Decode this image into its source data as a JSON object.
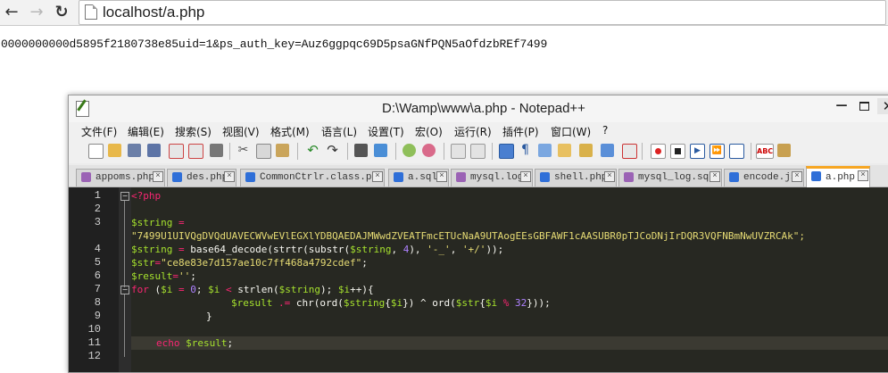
{
  "browser": {
    "back_icon": "arrow-left-icon",
    "forward_icon": "arrow-right-icon",
    "reload_icon": "reload-icon",
    "url": "localhost/a.php"
  },
  "page": {
    "output_text": "0000000000d5895f2180738e85uid=1&ps_auth_key=Auz6ggpqc69D5psaGNfPQN5aOfdzbREf7499"
  },
  "npp": {
    "title": "D:\\Wamp\\www\\a.php - Notepad++",
    "window_controls": {
      "minimize": "—",
      "close": "✕"
    },
    "menu": [
      "文件(F)",
      "编辑(E)",
      "搜索(S)",
      "视图(V)",
      "格式(M)",
      "语言(L)",
      "设置(T)",
      "宏(O)",
      "运行(R)",
      "插件(P)",
      "窗口(W)",
      "?"
    ],
    "toolbar_icons": [
      "new-file-icon",
      "open-file-icon",
      "save-icon",
      "save-all-icon",
      "close-icon",
      "close-all-icon",
      "print-icon",
      "cut-icon",
      "copy-icon",
      "paste-icon",
      "undo-icon",
      "redo-icon",
      "find-icon",
      "replace-icon",
      "zoom-in-icon",
      "zoom-out-icon",
      "sync-scroll-v-icon",
      "sync-scroll-h-icon",
      "word-wrap-icon",
      "show-all-chars-icon",
      "indent-guide-icon",
      "user-lang-icon",
      "doc-map-icon",
      "function-list-icon",
      "folder-workspace-icon",
      "record-macro-icon",
      "stop-macro-icon",
      "play-macro-icon",
      "run-macro-multiple-icon",
      "save-macro-icon",
      "spell-check-icon",
      "plugin-icon"
    ],
    "tabs": [
      {
        "label": "appoms.php",
        "active": false,
        "icon_color": "#9b63b5"
      },
      {
        "label": "des.php",
        "active": false,
        "icon_color": "#2f6fd8"
      },
      {
        "label": "CommonCtrlr.class.php",
        "active": false,
        "icon_color": "#2f6fd8"
      },
      {
        "label": "a.sql",
        "active": false,
        "icon_color": "#2f6fd8"
      },
      {
        "label": "mysql.log",
        "active": false,
        "icon_color": "#9b63b5"
      },
      {
        "label": "shell.php",
        "active": false,
        "icon_color": "#2f6fd8"
      },
      {
        "label": "mysql_log.sql",
        "active": false,
        "icon_color": "#9b63b5"
      },
      {
        "label": "encode.js",
        "active": false,
        "icon_color": "#2f6fd8"
      },
      {
        "label": "a.php",
        "active": true,
        "icon_color": "#2f6fd8"
      }
    ],
    "line_numbers": [
      "1",
      "2",
      "3",
      "4",
      "5",
      "6",
      "7",
      "8",
      "9",
      "10",
      "11",
      "12"
    ],
    "code": {
      "l1": "<?php",
      "l3a_var": "$string",
      "l3a_op": " =",
      "l3b_str": "\"7499U1UIVQgDVQdUAVECWVwEVlEGXlYDBQAEDAJMWwdZVEATFmcETUcNaA9UTAogEEsGBFAWF1cAASUBR0pTJCoDNjIrDQR3VQFNBmNwUVZRCAk\";",
      "l4_var": "$string",
      "l4_op": " = ",
      "l4_fn1": "base64_decode",
      "l4_p1": "(",
      "l4_fn2": "strtr",
      "l4_p2": "(",
      "l4_fn3": "substr",
      "l4_p3": "(",
      "l4_var2": "$string",
      "l4_c1": ", ",
      "l4_n1": "4",
      "l4_c2": "), ",
      "l4_s1": "'-_'",
      "l4_c3": ", ",
      "l4_s2": "'+/'",
      "l4_end": "));",
      "l5_var": "$str",
      "l5_op": "=",
      "l5_str": "\"ce8e83e7d157ae10c7ff468a4792cdef\"",
      "l5_end": ";",
      "l6_var": "$result",
      "l6_op": "=",
      "l6_str": "''",
      "l6_end": ";",
      "l7_kw": "for",
      "l7_a": " (",
      "l7_v1": "$i",
      "l7_b": " = ",
      "l7_n0": "0",
      "l7_c": "; ",
      "l7_v2": "$i",
      "l7_d": " < ",
      "l7_fn": "strlen",
      "l7_e": "(",
      "l7_v3": "$string",
      "l7_f": "); ",
      "l7_v4": "$i",
      "l7_g": "++){",
      "l8_var": "$result",
      "l8_op": " .= ",
      "l8_fn1": "chr",
      "l8_a": "(",
      "l8_fn2": "ord",
      "l8_b": "(",
      "l8_v1": "$string",
      "l8_c": "{",
      "l8_v2": "$i",
      "l8_d": "}) ^ ",
      "l8_fn3": "ord",
      "l8_e": "(",
      "l8_v3": "$str",
      "l8_f": "{",
      "l8_v4": "$i",
      "l8_g": " % ",
      "l8_n": "32",
      "l8_h": "}));",
      "l9": "}",
      "l11_kw": "echo",
      "l11_sp": " ",
      "l11_var": "$result",
      "l11_end": ";"
    }
  }
}
